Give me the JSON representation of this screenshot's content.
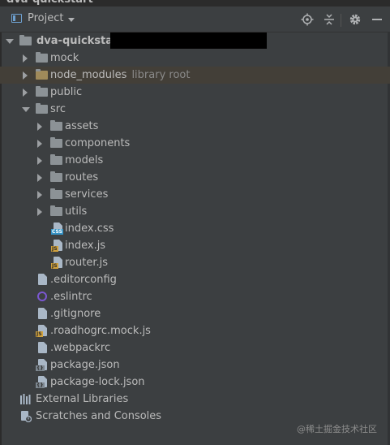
{
  "window": {
    "title_partial": "dva-quickstart"
  },
  "toolbar": {
    "view_label": "Project",
    "buttons": [
      "locate-icon",
      "collapse-all-icon",
      "gear-icon",
      "hide-icon"
    ]
  },
  "tree": {
    "root": {
      "label": "dva-quickstart",
      "expanded": true
    },
    "mock": "mock",
    "node_modules": {
      "label": "node_modules",
      "hint": "library root"
    },
    "public": "public",
    "src": {
      "label": "src",
      "expanded": true
    },
    "assets": "assets",
    "components": "components",
    "models": "models",
    "routes": "routes",
    "services": "services",
    "utils": "utils",
    "index_css": "index.css",
    "index_js": "index.js",
    "router_js": "router.js",
    "editorconfig": ".editorconfig",
    "eslintrc": ".eslintrc",
    "gitignore": ".gitignore",
    "roadhogrc": ".roadhogrc.mock.js",
    "webpackrc": ".webpackrc",
    "package_json": "package.json",
    "package_lock": "package-lock.json",
    "external_libraries": "External Libraries",
    "scratches": "Scratches and Consoles"
  },
  "watermark": "@稀土掘金技术社区",
  "colors": {
    "background": "#3c3f41",
    "text": "#bbbbbb",
    "hint": "#8a8a8a",
    "folder": "#8c9296",
    "highlight_row": "#433f38",
    "accent_blue": "#6ea1d1"
  }
}
